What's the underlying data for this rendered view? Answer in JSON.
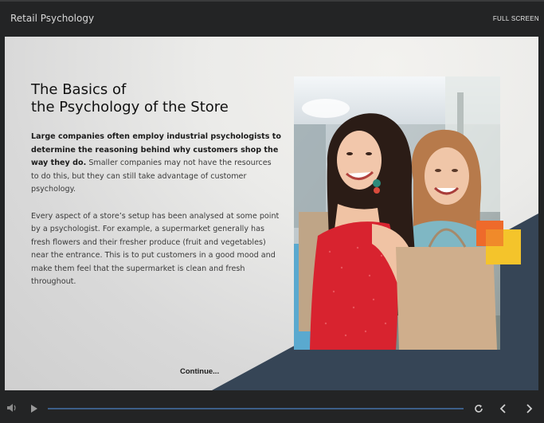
{
  "header": {
    "title": "Retail Psychology",
    "fullscreen_label": "FULL SCREEN"
  },
  "slide": {
    "heading_line1": "The Basics of",
    "heading_line2": "the Psychology of the Store",
    "para1_bold": "Large companies often employ industrial psychologists to determine the reasoning behind why customers shop the way they do.",
    "para1_rest": " Smaller companies may not have the resources to do this, but they can still take advantage of customer psychology.",
    "para2": "Every aspect of a store’s setup has been analysed at some point by a psychologist. For example, a supermarket generally has fresh flowers and their fresher produce (fruit and vegetables) near the entrance. This is to put customers in a good mood and make them feel that the supermarket is clean and fresh throughout.",
    "continue_label": "Continue...",
    "accent_colors": {
      "dark_navy": "#364556",
      "orange": "#ee6a2b",
      "yellow": "#f4c42b",
      "dress_red": "#d8232f"
    }
  },
  "player": {
    "progress": 0,
    "icons": [
      "volume-icon",
      "play-icon",
      "replay-icon",
      "previous-icon",
      "next-icon"
    ]
  }
}
